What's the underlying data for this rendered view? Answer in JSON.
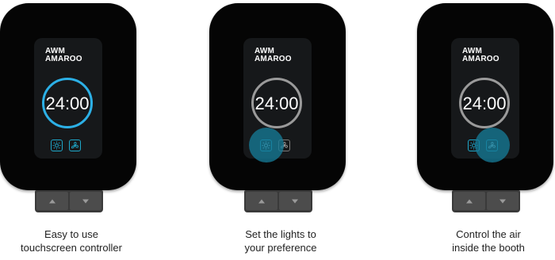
{
  "panels": [
    {
      "logo_line1": "AWM",
      "logo_line2": "AMAROO",
      "time": "24:00",
      "caption_line1": "Easy to use",
      "caption_line2": "touchscreen controller",
      "ring_active": true,
      "highlight": null
    },
    {
      "logo_line1": "AWM",
      "logo_line2": "AMAROO",
      "time": "24:00",
      "caption_line1": "Set the lights to",
      "caption_line2": "your preference",
      "ring_active": false,
      "highlight": "light"
    },
    {
      "logo_line1": "AWM",
      "logo_line2": "AMAROO",
      "time": "24:00",
      "caption_line1": "Control the air",
      "caption_line2": "inside the booth",
      "ring_active": false,
      "highlight": "fan"
    }
  ],
  "icons": {
    "light": "sun-icon",
    "fan": "fan-icon",
    "up": "up-arrow-icon",
    "down": "down-arrow-icon"
  },
  "colors": {
    "ring_active": "#2cb0e6",
    "ring_idle": "#9a9a9a",
    "button_border": "#1ea6c8",
    "highlight": "#167a96",
    "device_body": "#050505"
  }
}
